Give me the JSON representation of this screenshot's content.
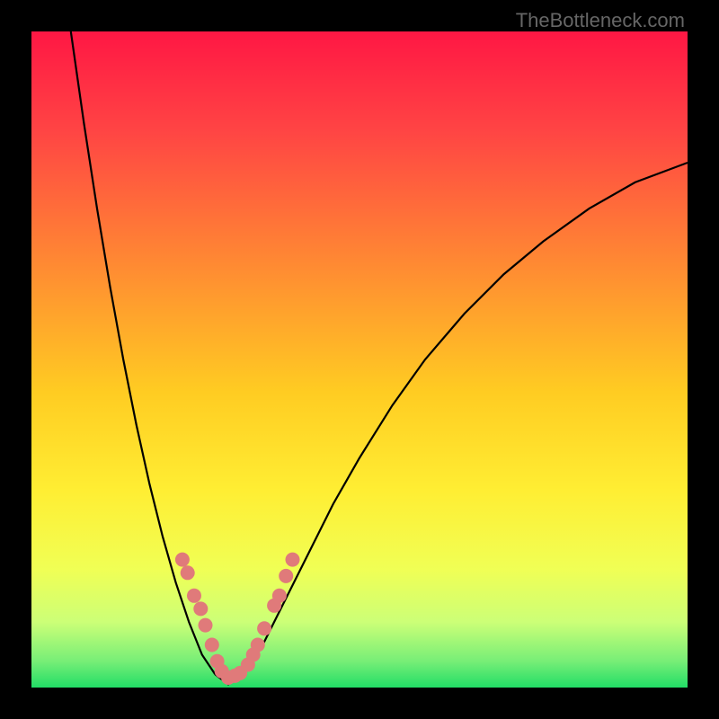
{
  "attribution": "TheBottleneck.com",
  "chart_data": {
    "type": "line",
    "title": "",
    "xlabel": "",
    "ylabel": "",
    "xlim": [
      0,
      100
    ],
    "ylim": [
      0,
      100
    ],
    "background": {
      "type": "gradient-vertical",
      "stops": [
        {
          "pos": 0,
          "color": "#ff1744"
        },
        {
          "pos": 15,
          "color": "#ff4444"
        },
        {
          "pos": 35,
          "color": "#ff8833"
        },
        {
          "pos": 55,
          "color": "#ffcc22"
        },
        {
          "pos": 70,
          "color": "#ffee33"
        },
        {
          "pos": 82,
          "color": "#f0ff55"
        },
        {
          "pos": 90,
          "color": "#ccff77"
        },
        {
          "pos": 96,
          "color": "#77ee77"
        },
        {
          "pos": 100,
          "color": "#22dd66"
        }
      ]
    },
    "series": [
      {
        "name": "curve-left",
        "type": "line",
        "x": [
          6,
          8,
          10,
          12,
          14,
          16,
          18,
          20,
          22,
          24,
          26,
          28
        ],
        "y": [
          100,
          86,
          73,
          61,
          50,
          40,
          31,
          23,
          16,
          10,
          5,
          2
        ]
      },
      {
        "name": "curve-right",
        "type": "line",
        "x": [
          32,
          35,
          38,
          42,
          46,
          50,
          55,
          60,
          66,
          72,
          78,
          85,
          92,
          100
        ],
        "y": [
          2,
          6,
          12,
          20,
          28,
          35,
          43,
          50,
          57,
          63,
          68,
          73,
          77,
          80
        ]
      },
      {
        "name": "valley-floor",
        "type": "line",
        "x": [
          28,
          30,
          32
        ],
        "y": [
          2,
          0.5,
          2
        ]
      }
    ],
    "markers": [
      {
        "x": 23.0,
        "y": 19.5
      },
      {
        "x": 23.8,
        "y": 17.5
      },
      {
        "x": 24.8,
        "y": 14.0
      },
      {
        "x": 25.8,
        "y": 12.0
      },
      {
        "x": 26.5,
        "y": 9.5
      },
      {
        "x": 27.5,
        "y": 6.5
      },
      {
        "x": 28.3,
        "y": 4.0
      },
      {
        "x": 29.0,
        "y": 2.5
      },
      {
        "x": 30.0,
        "y": 1.5
      },
      {
        "x": 31.0,
        "y": 1.8
      },
      {
        "x": 31.8,
        "y": 2.2
      },
      {
        "x": 33.0,
        "y": 3.5
      },
      {
        "x": 33.8,
        "y": 5.0
      },
      {
        "x": 34.5,
        "y": 6.5
      },
      {
        "x": 35.5,
        "y": 9.0
      },
      {
        "x": 37.0,
        "y": 12.5
      },
      {
        "x": 37.8,
        "y": 14.0
      },
      {
        "x": 38.8,
        "y": 17.0
      },
      {
        "x": 39.8,
        "y": 19.5
      }
    ],
    "marker_style": {
      "color": "#e07a7a",
      "radius": 8
    }
  }
}
